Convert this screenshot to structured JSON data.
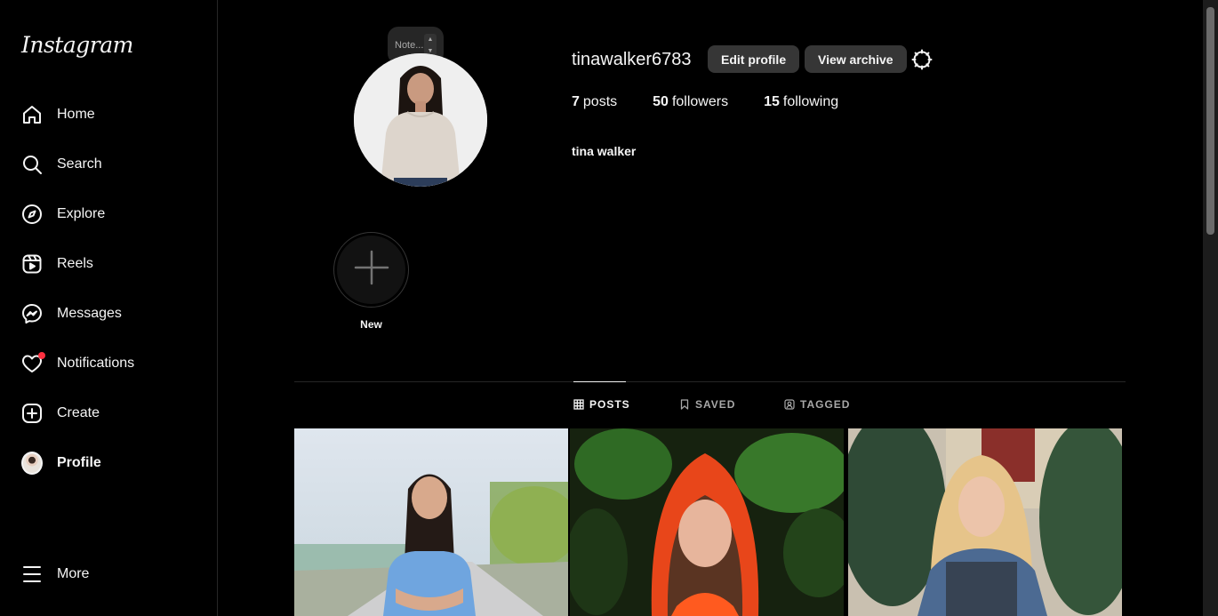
{
  "sidebar": {
    "logo": "Instagram",
    "items": [
      {
        "label": "Home",
        "icon": "home-icon"
      },
      {
        "label": "Search",
        "icon": "search-icon"
      },
      {
        "label": "Explore",
        "icon": "compass-icon"
      },
      {
        "label": "Reels",
        "icon": "reels-icon"
      },
      {
        "label": "Messages",
        "icon": "messenger-icon"
      },
      {
        "label": "Notifications",
        "icon": "heart-icon"
      },
      {
        "label": "Create",
        "icon": "plus-square-icon"
      },
      {
        "label": "Profile",
        "icon": "avatar"
      }
    ],
    "more_label": "More"
  },
  "profile": {
    "note_placeholder": "Note...",
    "username": "tinawalker6783",
    "edit_profile_label": "Edit profile",
    "view_archive_label": "View archive",
    "posts_count": "7",
    "posts_label": "posts",
    "followers_count": "50",
    "followers_label": "followers",
    "following_count": "15",
    "following_label": "following",
    "full_name": "tina walker"
  },
  "highlights": {
    "new_label": "New"
  },
  "tabs": [
    {
      "label": "POSTS",
      "icon": "grid-icon",
      "active": true
    },
    {
      "label": "SAVED",
      "icon": "bookmark-icon",
      "active": false
    },
    {
      "label": "TAGGED",
      "icon": "tagged-icon",
      "active": false
    }
  ],
  "colors": {
    "background": "#000000",
    "text": "#f5f5f5",
    "button": "#363636",
    "notification_dot": "#ff3040"
  }
}
